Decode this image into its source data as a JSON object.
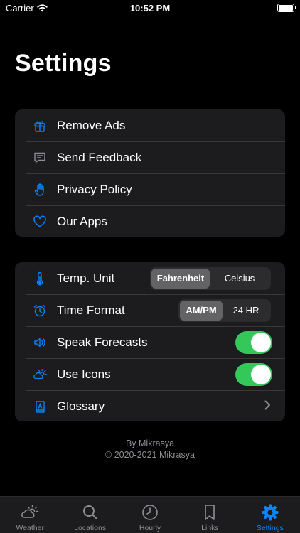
{
  "status_bar": {
    "carrier": "Carrier",
    "time": "10:52 PM"
  },
  "page": {
    "title": "Settings"
  },
  "group1": [
    {
      "label": "Remove Ads",
      "icon": "gift-icon"
    },
    {
      "label": "Send Feedback",
      "icon": "chat-bubble-icon"
    },
    {
      "label": "Privacy Policy",
      "icon": "hand-icon"
    },
    {
      "label": "Our Apps",
      "icon": "heart-icon"
    }
  ],
  "group2": {
    "temp_unit": {
      "label": "Temp. Unit",
      "options": [
        "Fahrenheit",
        "Celsius"
      ],
      "selected": "Fahrenheit"
    },
    "time_format": {
      "label": "Time Format",
      "options": [
        "AM/PM",
        "24 HR"
      ],
      "selected": "AM/PM"
    },
    "speak_forecasts": {
      "label": "Speak Forecasts",
      "on": true
    },
    "use_icons": {
      "label": "Use Icons",
      "on": true
    },
    "glossary": {
      "label": "Glossary"
    }
  },
  "footer": {
    "line1": "By Mikrasya",
    "line2": "© 2020-2021 Mikrasya"
  },
  "tabs": [
    {
      "label": "Weather",
      "icon": "weather-icon"
    },
    {
      "label": "Locations",
      "icon": "search-icon"
    },
    {
      "label": "Hourly",
      "icon": "clock-icon"
    },
    {
      "label": "Links",
      "icon": "bookmark-icon"
    },
    {
      "label": "Settings",
      "icon": "gear-icon",
      "active": true
    }
  ],
  "colors": {
    "accent": "#0a84ff",
    "toggle_on": "#34c759",
    "cell_bg": "#1c1c1e",
    "background": "#000000"
  }
}
